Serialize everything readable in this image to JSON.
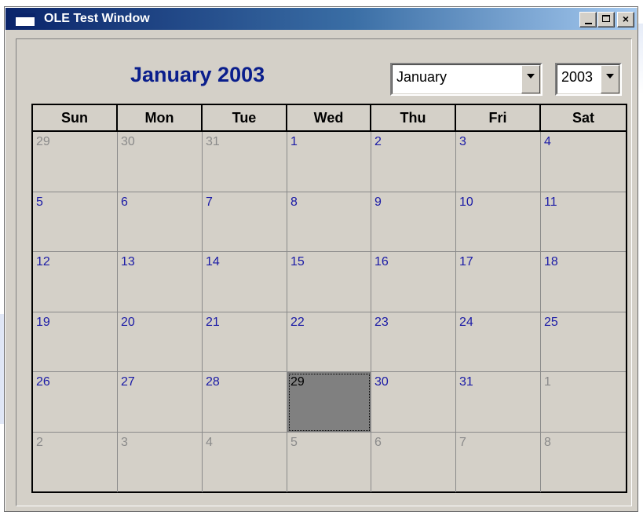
{
  "window": {
    "title": "OLE Test Window",
    "minimize_label": "_",
    "close_label": "×"
  },
  "calendar": {
    "heading": "January 2003",
    "month_select": {
      "value": "January"
    },
    "year_select": {
      "value": "2003"
    },
    "weekdays": [
      "Sun",
      "Mon",
      "Tue",
      "Wed",
      "Thu",
      "Fri",
      "Sat"
    ],
    "weeks": [
      [
        {
          "d": "29",
          "cur": false
        },
        {
          "d": "30",
          "cur": false
        },
        {
          "d": "31",
          "cur": false
        },
        {
          "d": "1",
          "cur": true
        },
        {
          "d": "2",
          "cur": true
        },
        {
          "d": "3",
          "cur": true
        },
        {
          "d": "4",
          "cur": true
        }
      ],
      [
        {
          "d": "5",
          "cur": true
        },
        {
          "d": "6",
          "cur": true
        },
        {
          "d": "7",
          "cur": true
        },
        {
          "d": "8",
          "cur": true
        },
        {
          "d": "9",
          "cur": true
        },
        {
          "d": "10",
          "cur": true
        },
        {
          "d": "11",
          "cur": true
        }
      ],
      [
        {
          "d": "12",
          "cur": true
        },
        {
          "d": "13",
          "cur": true
        },
        {
          "d": "14",
          "cur": true
        },
        {
          "d": "15",
          "cur": true
        },
        {
          "d": "16",
          "cur": true
        },
        {
          "d": "17",
          "cur": true
        },
        {
          "d": "18",
          "cur": true
        }
      ],
      [
        {
          "d": "19",
          "cur": true
        },
        {
          "d": "20",
          "cur": true
        },
        {
          "d": "21",
          "cur": true
        },
        {
          "d": "22",
          "cur": true
        },
        {
          "d": "23",
          "cur": true
        },
        {
          "d": "24",
          "cur": true
        },
        {
          "d": "25",
          "cur": true
        }
      ],
      [
        {
          "d": "26",
          "cur": true
        },
        {
          "d": "27",
          "cur": true
        },
        {
          "d": "28",
          "cur": true
        },
        {
          "d": "29",
          "cur": true,
          "selected": true
        },
        {
          "d": "30",
          "cur": true
        },
        {
          "d": "31",
          "cur": true
        },
        {
          "d": "1",
          "cur": false
        }
      ],
      [
        {
          "d": "2",
          "cur": false
        },
        {
          "d": "3",
          "cur": false
        },
        {
          "d": "4",
          "cur": false
        },
        {
          "d": "5",
          "cur": false
        },
        {
          "d": "6",
          "cur": false
        },
        {
          "d": "7",
          "cur": false
        },
        {
          "d": "8",
          "cur": false
        }
      ]
    ]
  },
  "colors": {
    "heading": "#0a1e8c",
    "current_month_day": "#1a1aa6",
    "other_month_day": "#8a8a8a",
    "selected_bg": "#808080",
    "face": "#d4d0c8"
  }
}
